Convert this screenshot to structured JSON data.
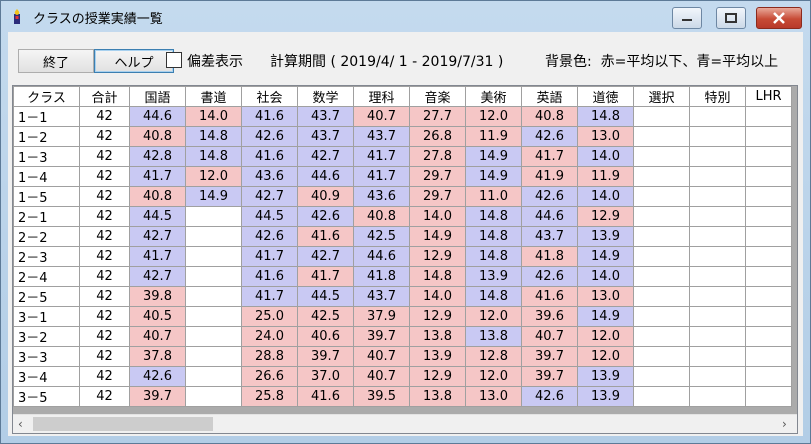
{
  "window": {
    "title": "クラスの授業実績一覧"
  },
  "toolbar": {
    "end_label": "終了",
    "help_label": "ヘルプ",
    "deviation_label": "偏差表示",
    "deviation_checked": false,
    "period_text": "計算期間 ( 2019/4/ 1 - 2019/7/31 )",
    "legend_text": "背景色:  赤=平均以下、青=平均以上"
  },
  "colors": {
    "below_avg": "#f5c6c6",
    "above_avg": "#c9c9f3"
  },
  "table": {
    "headers": [
      "クラス",
      "合計",
      "国語",
      "書道",
      "社会",
      "数学",
      "理科",
      "音楽",
      "美術",
      "英語",
      "道徳",
      "選択",
      "特別",
      "LHR"
    ],
    "rows": [
      {
        "cells": [
          "1－1",
          "42",
          "44.6",
          "14.0",
          "41.6",
          "43.7",
          "40.7",
          "27.7",
          "12.0",
          "40.8",
          "14.8",
          "",
          "",
          ""
        ],
        "colors": [
          "",
          "",
          "b",
          "r",
          "b",
          "b",
          "r",
          "r",
          "r",
          "r",
          "b",
          "",
          "",
          ""
        ]
      },
      {
        "cells": [
          "1－2",
          "42",
          "40.8",
          "14.8",
          "42.6",
          "43.7",
          "43.7",
          "26.8",
          "11.9",
          "42.6",
          "13.0",
          "",
          "",
          ""
        ],
        "colors": [
          "",
          "",
          "r",
          "b",
          "b",
          "b",
          "b",
          "r",
          "r",
          "b",
          "r",
          "",
          "",
          ""
        ]
      },
      {
        "cells": [
          "1－3",
          "42",
          "42.8",
          "14.8",
          "41.6",
          "42.7",
          "41.7",
          "27.8",
          "14.9",
          "41.7",
          "14.0",
          "",
          "",
          ""
        ],
        "colors": [
          "",
          "",
          "b",
          "b",
          "b",
          "b",
          "b",
          "r",
          "b",
          "r",
          "b",
          "",
          "",
          ""
        ]
      },
      {
        "cells": [
          "1－4",
          "42",
          "41.7",
          "12.0",
          "43.6",
          "44.6",
          "41.7",
          "29.7",
          "14.9",
          "41.9",
          "11.9",
          "",
          "",
          ""
        ],
        "colors": [
          "",
          "",
          "b",
          "r",
          "b",
          "b",
          "b",
          "r",
          "b",
          "r",
          "r",
          "",
          "",
          ""
        ]
      },
      {
        "cells": [
          "1－5",
          "42",
          "40.8",
          "14.9",
          "42.7",
          "40.9",
          "43.6",
          "29.7",
          "11.0",
          "42.6",
          "14.0",
          "",
          "",
          ""
        ],
        "colors": [
          "",
          "",
          "r",
          "b",
          "b",
          "r",
          "b",
          "r",
          "r",
          "b",
          "b",
          "",
          "",
          ""
        ]
      },
      {
        "cells": [
          "2－1",
          "42",
          "44.5",
          "",
          "44.5",
          "42.6",
          "40.8",
          "14.0",
          "14.8",
          "44.6",
          "12.9",
          "",
          "",
          ""
        ],
        "colors": [
          "",
          "",
          "b",
          "",
          "b",
          "b",
          "r",
          "r",
          "b",
          "b",
          "r",
          "",
          "",
          ""
        ]
      },
      {
        "cells": [
          "2－2",
          "42",
          "42.7",
          "",
          "42.6",
          "41.6",
          "42.5",
          "14.9",
          "14.8",
          "43.7",
          "13.9",
          "",
          "",
          ""
        ],
        "colors": [
          "",
          "",
          "b",
          "",
          "b",
          "r",
          "b",
          "r",
          "b",
          "b",
          "b",
          "",
          "",
          ""
        ]
      },
      {
        "cells": [
          "2－3",
          "42",
          "41.7",
          "",
          "41.7",
          "42.7",
          "44.6",
          "12.9",
          "14.8",
          "41.8",
          "14.9",
          "",
          "",
          ""
        ],
        "colors": [
          "",
          "",
          "b",
          "",
          "b",
          "b",
          "b",
          "r",
          "b",
          "r",
          "b",
          "",
          "",
          ""
        ]
      },
      {
        "cells": [
          "2－4",
          "42",
          "42.7",
          "",
          "41.6",
          "41.7",
          "41.8",
          "14.8",
          "13.9",
          "42.6",
          "14.0",
          "",
          "",
          ""
        ],
        "colors": [
          "",
          "",
          "b",
          "",
          "b",
          "r",
          "b",
          "r",
          "b",
          "b",
          "b",
          "",
          "",
          ""
        ]
      },
      {
        "cells": [
          "2－5",
          "42",
          "39.8",
          "",
          "41.7",
          "44.5",
          "43.7",
          "14.0",
          "14.8",
          "41.6",
          "13.0",
          "",
          "",
          ""
        ],
        "colors": [
          "",
          "",
          "r",
          "",
          "b",
          "b",
          "b",
          "r",
          "b",
          "r",
          "r",
          "",
          "",
          ""
        ]
      },
      {
        "cells": [
          "3－1",
          "42",
          "40.5",
          "",
          "25.0",
          "42.5",
          "37.9",
          "12.9",
          "12.0",
          "39.6",
          "14.9",
          "",
          "",
          ""
        ],
        "colors": [
          "",
          "",
          "r",
          "",
          "r",
          "r",
          "r",
          "r",
          "r",
          "r",
          "b",
          "",
          "",
          ""
        ]
      },
      {
        "cells": [
          "3－2",
          "42",
          "40.7",
          "",
          "24.0",
          "40.6",
          "39.7",
          "13.8",
          "13.8",
          "40.7",
          "12.0",
          "",
          "",
          ""
        ],
        "colors": [
          "",
          "",
          "r",
          "",
          "r",
          "r",
          "r",
          "r",
          "b",
          "r",
          "r",
          "",
          "",
          ""
        ]
      },
      {
        "cells": [
          "3－3",
          "42",
          "37.8",
          "",
          "28.8",
          "39.7",
          "40.7",
          "13.9",
          "12.8",
          "39.7",
          "12.0",
          "",
          "",
          ""
        ],
        "colors": [
          "",
          "",
          "r",
          "",
          "r",
          "r",
          "r",
          "r",
          "r",
          "r",
          "r",
          "",
          "",
          ""
        ]
      },
      {
        "cells": [
          "3－4",
          "42",
          "42.6",
          "",
          "26.6",
          "37.0",
          "40.7",
          "12.9",
          "12.0",
          "39.7",
          "13.9",
          "",
          "",
          ""
        ],
        "colors": [
          "",
          "",
          "b",
          "",
          "r",
          "r",
          "r",
          "r",
          "r",
          "r",
          "b",
          "",
          "",
          ""
        ]
      },
      {
        "cells": [
          "3－5",
          "42",
          "39.7",
          "",
          "25.8",
          "41.6",
          "39.5",
          "13.8",
          "13.0",
          "42.6",
          "13.9",
          "",
          "",
          ""
        ],
        "colors": [
          "",
          "",
          "r",
          "",
          "r",
          "r",
          "r",
          "r",
          "r",
          "b",
          "b",
          "",
          "",
          ""
        ]
      }
    ]
  },
  "scrollbar": {
    "left_arrow": "‹",
    "right_arrow": "›"
  }
}
